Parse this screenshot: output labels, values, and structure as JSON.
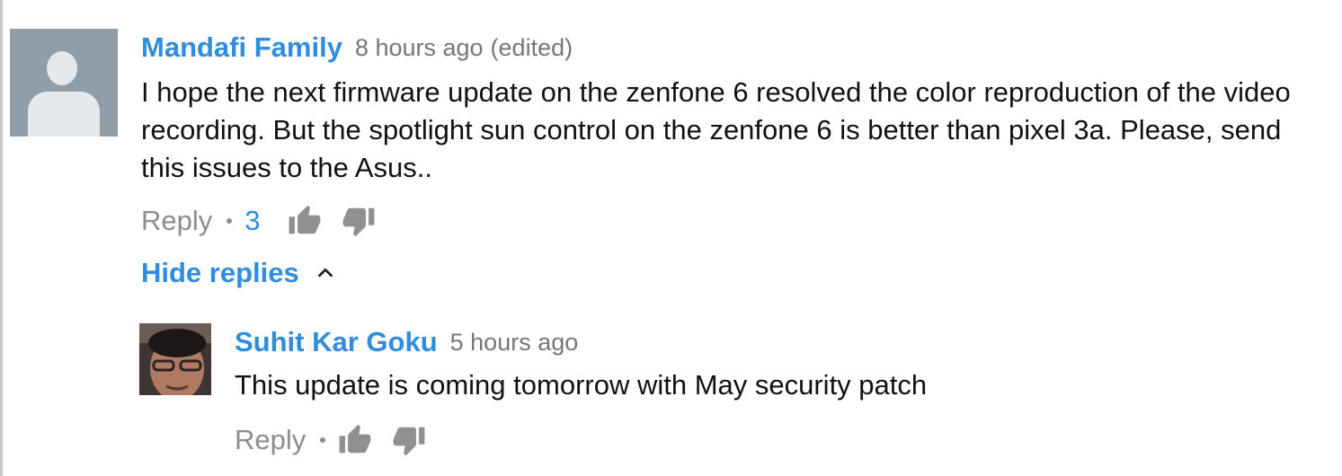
{
  "comment": {
    "author": "Mandafi Family",
    "time": "8 hours ago",
    "edited": "(edited)",
    "text": "I hope the next firmware update on the zenfone 6 resolved the color reproduction of the video recording. But the spotlight sun control on the zenfone 6 is better than pixel 3a. Please, send this issues to the Asus..",
    "reply_label": "Reply",
    "like_count": "3",
    "hide_replies_label": "Hide replies"
  },
  "reply": {
    "author": "Suhit Kar Goku",
    "time": "5 hours ago",
    "text": "This update is coming tomorrow with May security patch",
    "reply_label": "Reply"
  },
  "icons": {
    "avatar_default": "default-user-avatar-icon",
    "thumb_up": "thumbs-up-icon",
    "thumb_down": "thumbs-down-icon",
    "chevron": "chevron-up-icon"
  },
  "colors": {
    "link_blue": "#2f8cde",
    "muted_gray": "#8d8d8d",
    "avatar_bg": "#8f9ea9",
    "icon_gray": "#909090"
  }
}
